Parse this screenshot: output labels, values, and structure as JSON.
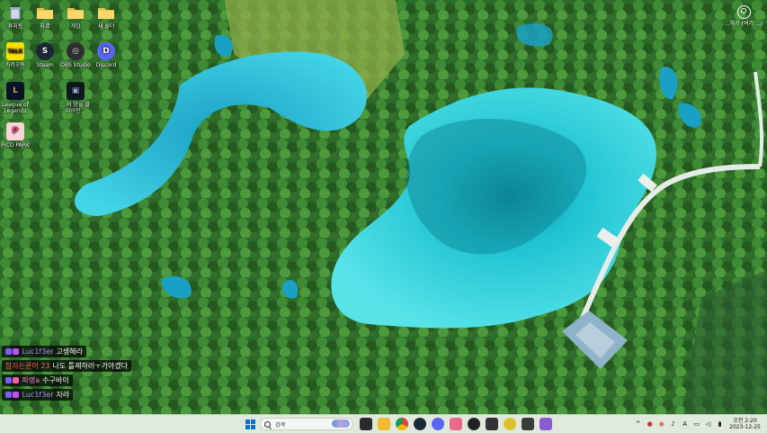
{
  "desktop": {
    "icons": [
      {
        "label": "휴지통",
        "icon": "recycle-bin-icon"
      },
      {
        "label": "자료",
        "icon": "folder-icon"
      },
      {
        "label": "게임",
        "icon": "folder-icon"
      },
      {
        "label": "새 폴더",
        "icon": "folder-icon"
      },
      {
        "label": "카카오톡",
        "icon": "kakaotalk-icon",
        "glyph": "TALK"
      },
      {
        "label": "Steam",
        "icon": "steam-icon",
        "glyph": "S"
      },
      {
        "label": "OBS Studio",
        "icon": "obs-icon",
        "glyph": "◎"
      },
      {
        "label": "Discord",
        "icon": "discord-icon",
        "glyph": "D"
      },
      {
        "label": "League of Legends",
        "icon": "league-of-legends-icon",
        "glyph": "L"
      },
      {
        "label": "...의 밤을 클리어한...",
        "icon": "game-shortcut-icon",
        "glyph": "▣"
      },
      {
        "label": "PICO PARK",
        "icon": "pico-park-icon",
        "glyph": "P"
      }
    ],
    "user": {
      "label": "...하기 (여기 ...)",
      "icon": "user-account-icon"
    }
  },
  "chat": {
    "messages": [
      {
        "nick": "Luc1f3er",
        "nick_color": "#a58bff",
        "text": "고생해라"
      },
      {
        "nick": "잠자는룬어 23",
        "nick_color": "#ff5a5a",
        "text": "나도 틀제하러ㅜ가야겠다"
      },
      {
        "nick": "파랭a",
        "nick_color": "#ff7ad9",
        "text": "수구바이"
      },
      {
        "nick": "Luc1f3er",
        "nick_color": "#a58bff",
        "text": "자라"
      }
    ]
  },
  "taskbar": {
    "search_placeholder": "검색",
    "pinned": [
      {
        "icon": "task-view-icon"
      },
      {
        "icon": "file-explorer-icon"
      },
      {
        "icon": "chrome-icon"
      },
      {
        "icon": "steam-icon"
      },
      {
        "icon": "discord-icon"
      },
      {
        "icon": "photos-icon"
      },
      {
        "icon": "app-icon"
      },
      {
        "icon": "game-icon"
      },
      {
        "icon": "record-icon"
      },
      {
        "icon": "terminal-icon"
      },
      {
        "icon": "utility-icon"
      }
    ],
    "tray": {
      "ime": "A"
    },
    "clock": {
      "time": "오전 2:20",
      "date": "2023-12-25"
    }
  },
  "colors": {
    "water": "#2fd3e0",
    "forest": "#2e6d2b",
    "taskbar": "#dfe9dc",
    "accent": "#0a6fd6"
  }
}
